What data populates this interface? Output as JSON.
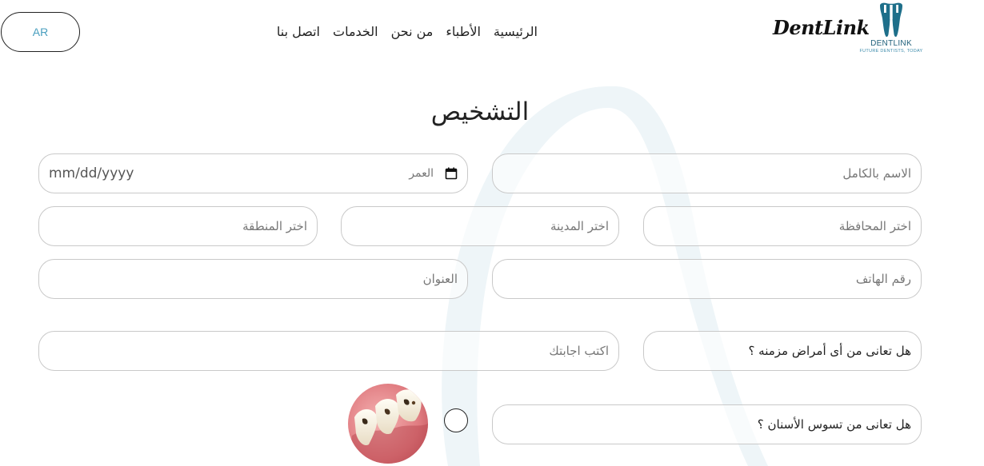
{
  "header": {
    "language_button": "AR",
    "nav": [
      "الرئيسية",
      "الأطباء",
      "من نحن",
      "الخدمات",
      "اتصل بنا"
    ],
    "brand_script": "DentLink",
    "logo_name": "DENTLINK",
    "logo_tagline": "FUTURE DENTISTS, TODAY"
  },
  "page": {
    "title": "التشخيص"
  },
  "form": {
    "full_name_placeholder": "الاسم بالكامل",
    "age_label": "العمر",
    "age_date_placeholder": "mm/dd/yyyy",
    "governorate_placeholder": "اختر المحافظة",
    "city_placeholder": "اختر المدينة",
    "region_placeholder": "اختر المنطقة",
    "phone_placeholder": "رقم الهاتف",
    "address_placeholder": "العنوان",
    "chronic_question": "هل تعانى من أى أمراض مزمنه ؟",
    "answer_placeholder": "اكتب اجابتك",
    "decay_question": "هل تعانى من تسوس الأسنان ؟"
  },
  "colors": {
    "accent": "#4a9fbf",
    "logo_teal": "#1e6f8a",
    "border": "#c9c9c9",
    "bg_shape": "#eef5f8"
  }
}
